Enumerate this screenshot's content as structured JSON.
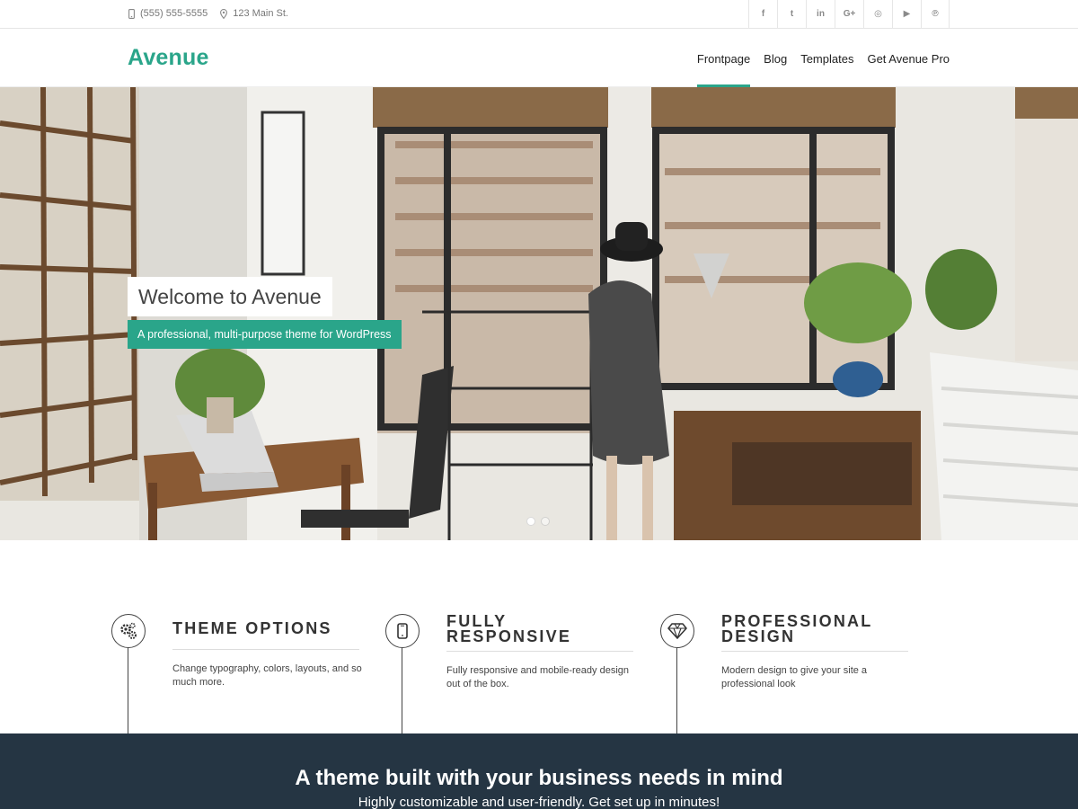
{
  "topbar": {
    "phone": "(555) 555-5555",
    "phone_icon": "mobile-phone-icon",
    "address": "123 Main St.",
    "address_icon": "map-marker-icon",
    "social": [
      {
        "name": "facebook-icon",
        "glyph": "f"
      },
      {
        "name": "twitter-icon",
        "glyph": "t"
      },
      {
        "name": "linkedin-icon",
        "glyph": "in"
      },
      {
        "name": "google-plus-icon",
        "glyph": "G+"
      },
      {
        "name": "instagram-icon",
        "glyph": "◎"
      },
      {
        "name": "youtube-icon",
        "glyph": "▶"
      },
      {
        "name": "pinterest-icon",
        "glyph": "℗"
      }
    ]
  },
  "header": {
    "logo": "Avenue",
    "nav": [
      "Frontpage",
      "Blog",
      "Templates",
      "Get Avenue Pro"
    ],
    "active_nav": "Frontpage"
  },
  "hero": {
    "title": "Welcome to Avenue",
    "subtitle": "A professional, multi-purpose theme for WordPress",
    "slides": 2,
    "active_slide": 1
  },
  "features": [
    {
      "icon": "gears-icon",
      "title": "THEME OPTIONS",
      "desc": "Change typography, colors, layouts, and so much more."
    },
    {
      "icon": "mobile-icon",
      "title": "FULLY RESPONSIVE",
      "desc": "Fully responsive and mobile-ready design out of the box."
    },
    {
      "icon": "diamond-icon",
      "title": "PROFESSIONAL DESIGN",
      "desc": "Modern design to give your site a professional look"
    }
  ],
  "cta": {
    "title": "A theme built with your business needs in mind",
    "subtitle": "Highly customizable and user-friendly. Get set up in minutes!"
  },
  "colors": {
    "accent": "#2aa58a",
    "cta_background": "#253543"
  }
}
